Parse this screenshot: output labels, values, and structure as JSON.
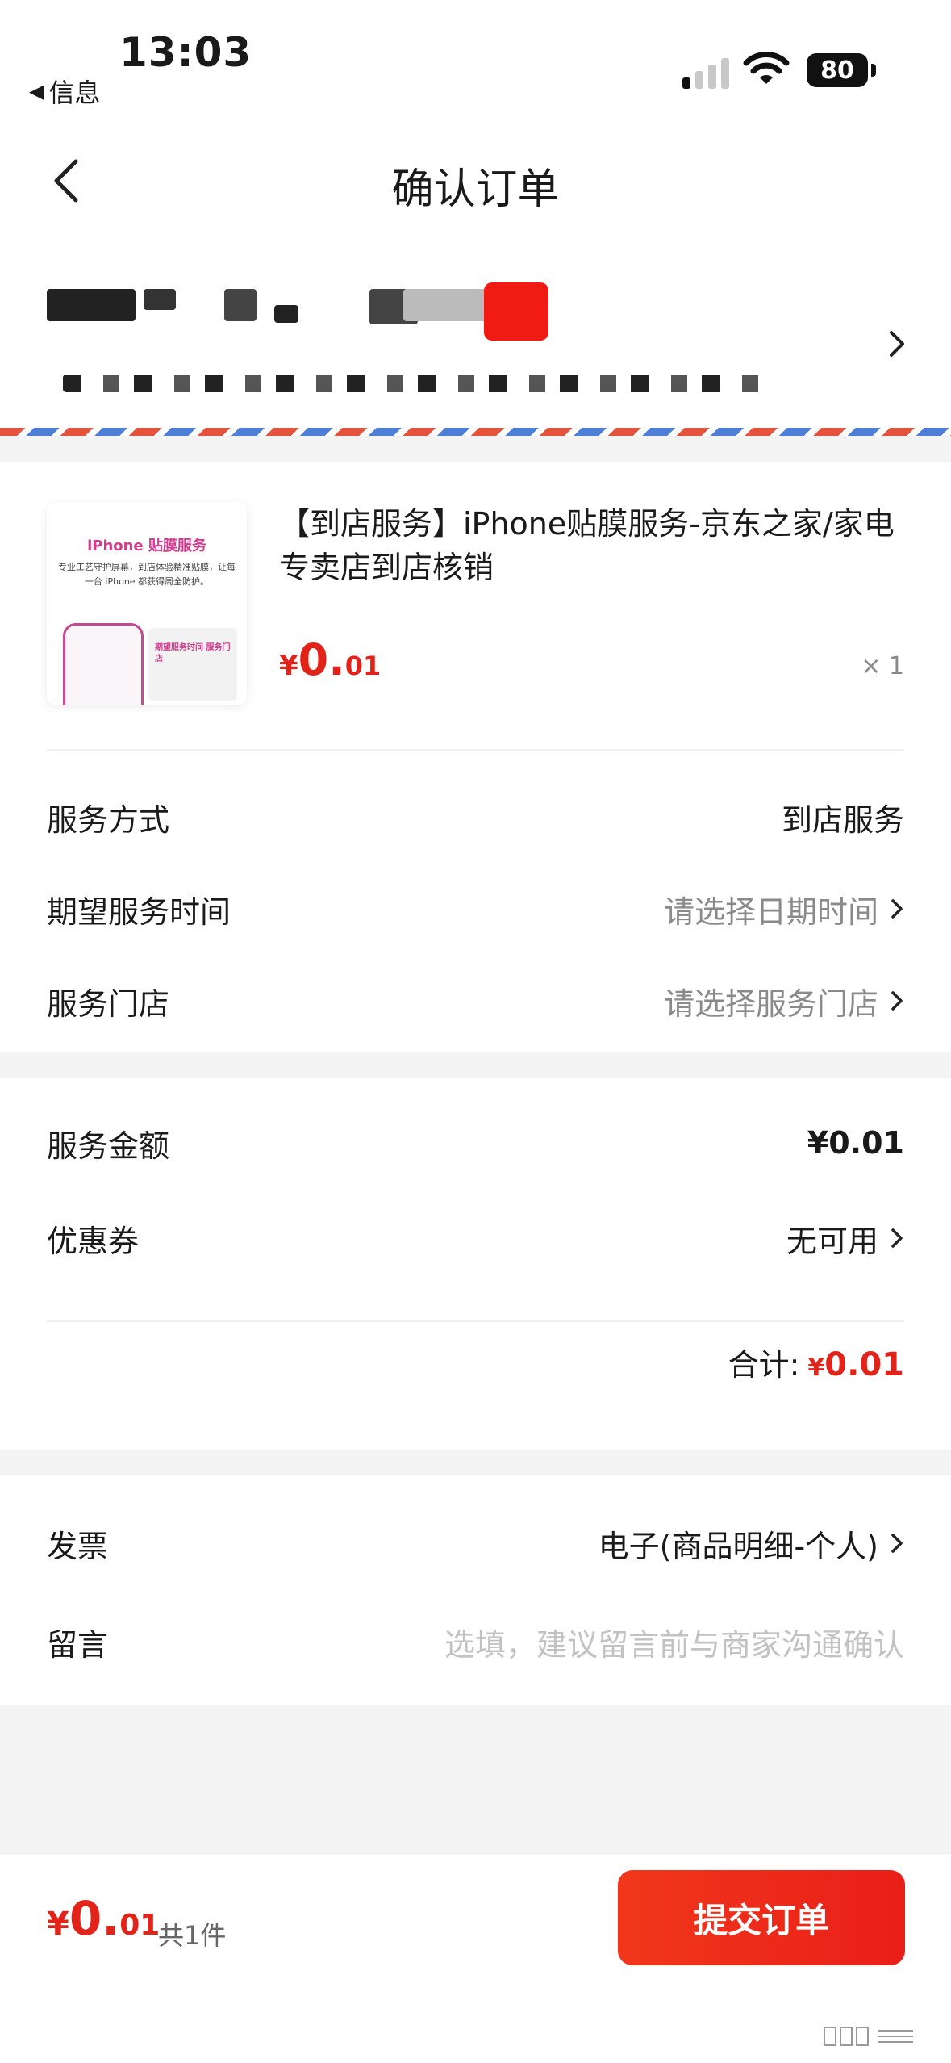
{
  "status_bar": {
    "time": "13:03",
    "back_app_label": "信息",
    "battery": "80"
  },
  "nav": {
    "title": "确认订单"
  },
  "product": {
    "thumb_title": "iPhone 贴膜服务",
    "thumb_desc": "专业工艺守护屏幕，到店体验精准贴膜，让每一台 iPhone 都获得周全防护。",
    "thumb_panel_text": "期望服务时间 服务门店",
    "title": "【到店服务】iPhone贴膜服务-京东之家/家电专卖店到店核销",
    "price_yen": "¥",
    "price_int": "0.",
    "price_dec": "01",
    "quantity": "× 1"
  },
  "service": {
    "method_label": "服务方式",
    "method_value": "到店服务",
    "time_label": "期望服务时间",
    "time_value": "请选择日期时间",
    "store_label": "服务门店",
    "store_value": "请选择服务门店"
  },
  "amounts": {
    "service_amount_label": "服务金额",
    "service_amount_value": "¥0.01",
    "coupon_label": "优惠券",
    "coupon_value": "无可用",
    "total_label": "合计:",
    "total_yen": "¥",
    "total_value": "0.01"
  },
  "extras": {
    "invoice_label": "发票",
    "invoice_value": "电子(商品明细-个人)",
    "message_label": "留言",
    "message_placeholder": "选填，建议留言前与商家沟通确认"
  },
  "bottom_bar": {
    "price_yen": "¥",
    "price_int": "0.",
    "price_dec": "01",
    "count": "共1件",
    "submit_label": "提交订单"
  },
  "colors": {
    "accent_red": "#e2231a",
    "muted_text": "#8a8a8a",
    "background": "#f4f4f4"
  }
}
